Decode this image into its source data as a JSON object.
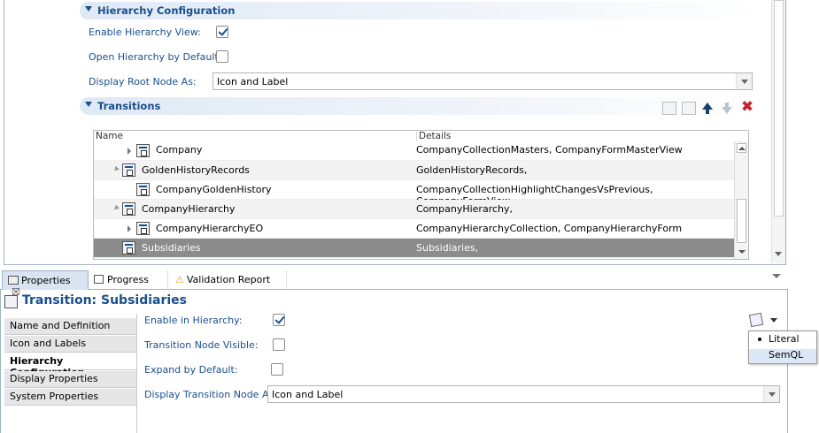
{
  "hierarchy_section": {
    "title": "Hierarchy Configuration",
    "enable_label": "Enable Hierarchy View:",
    "enable_checked": true,
    "open_default_label": "Open Hierarchy by Default:",
    "open_default_checked": false,
    "display_root_label": "Display Root Node As:",
    "display_root_value": "Icon and Label"
  },
  "transitions_section": {
    "title": "Transitions",
    "columns": [
      "Name",
      "Details"
    ],
    "rows": [
      {
        "name": "Company",
        "details": "CompanyCollectionMasters, CompanyFormMasterView"
      },
      {
        "name": "GoldenHistoryRecords",
        "details": "GoldenHistoryRecords,"
      },
      {
        "name": "CompanyGoldenHistory",
        "details": "CompanyCollectionHighlightChangesVsPrevious, CompanyFormView"
      },
      {
        "name": "CompanyHierarchy",
        "details": "CompanyHierarchy,"
      },
      {
        "name": "CompanyHierarchyEO",
        "details": "CompanyHierarchyCollection, CompanyHierarchyForm"
      },
      {
        "name": "Subsidiaries",
        "details": "Subsidiaries,"
      }
    ]
  },
  "bottom_tabs": {
    "properties": "Properties",
    "progress": "Progress",
    "validation": "Validation Report"
  },
  "properties_panel": {
    "title": "Transition: Subsidiaries",
    "nav": [
      "Name and Definition",
      "Icon and Labels",
      "Hierarchy Configuration",
      "Display Properties",
      "System Properties"
    ],
    "selected_nav": "Hierarchy Configuration",
    "enable_label": "Enable in Hierarchy:",
    "enable_checked": true,
    "visible_label": "Transition Node Visible:",
    "visible_checked": false,
    "expand_label": "Expand by Default:",
    "expand_checked": false,
    "display_node_label": "Display Transition Node As:",
    "display_node_value": "Icon and Label"
  },
  "popup_menu": {
    "items": [
      "Literal",
      "SemQL"
    ],
    "selected": "Literal"
  },
  "colors": {
    "accent": "#1a4f8e",
    "selected_row": "#8c8c8c",
    "delete": "#c8202a"
  }
}
